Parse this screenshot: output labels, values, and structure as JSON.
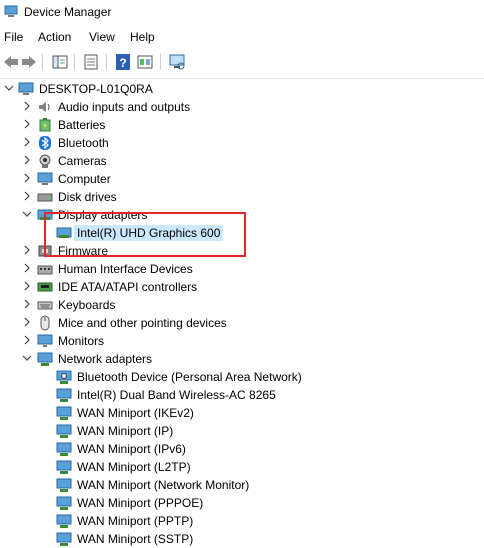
{
  "window": {
    "title": "Device Manager"
  },
  "menu": [
    "File",
    "Action",
    "View",
    "Help"
  ],
  "tree": {
    "root": "DESKTOP-L01Q0RA",
    "categories": [
      {
        "label": "Audio inputs and outputs",
        "icon": "speaker-icon"
      },
      {
        "label": "Batteries",
        "icon": "battery-icon"
      },
      {
        "label": "Bluetooth",
        "icon": "bluetooth-icon"
      },
      {
        "label": "Cameras",
        "icon": "camera-icon"
      },
      {
        "label": "Computer",
        "icon": "computer-icon"
      },
      {
        "label": "Disk drives",
        "icon": "disk-drive-icon"
      },
      {
        "label": "Display adapters",
        "icon": "display-adapter-icon"
      },
      {
        "label": "Firmware",
        "icon": "firmware-icon"
      },
      {
        "label": "Human Interface Devices",
        "icon": "hid-icon"
      },
      {
        "label": "IDE ATA/ATAPI controllers",
        "icon": "ide-controller-icon"
      },
      {
        "label": "Keyboards",
        "icon": "keyboard-icon"
      },
      {
        "label": "Mice and other pointing devices",
        "icon": "mouse-icon"
      },
      {
        "label": "Monitors",
        "icon": "monitor-icon"
      },
      {
        "label": "Network adapters",
        "icon": "network-adapter-icon"
      }
    ],
    "display_children": [
      "Intel(R) UHD Graphics 600"
    ],
    "network_children": [
      "Bluetooth Device (Personal Area Network)",
      "Intel(R) Dual Band Wireless-AC 8265",
      "WAN Miniport (IKEv2)",
      "WAN Miniport (IP)",
      "WAN Miniport (IPv6)",
      "WAN Miniport (L2TP)",
      "WAN Miniport (Network Monitor)",
      "WAN Miniport (PPPOE)",
      "WAN Miniport (PPTP)",
      "WAN Miniport (SSTP)"
    ]
  },
  "colors": {
    "selection": "#cce8ff",
    "highlight_box": "#e0292b"
  }
}
